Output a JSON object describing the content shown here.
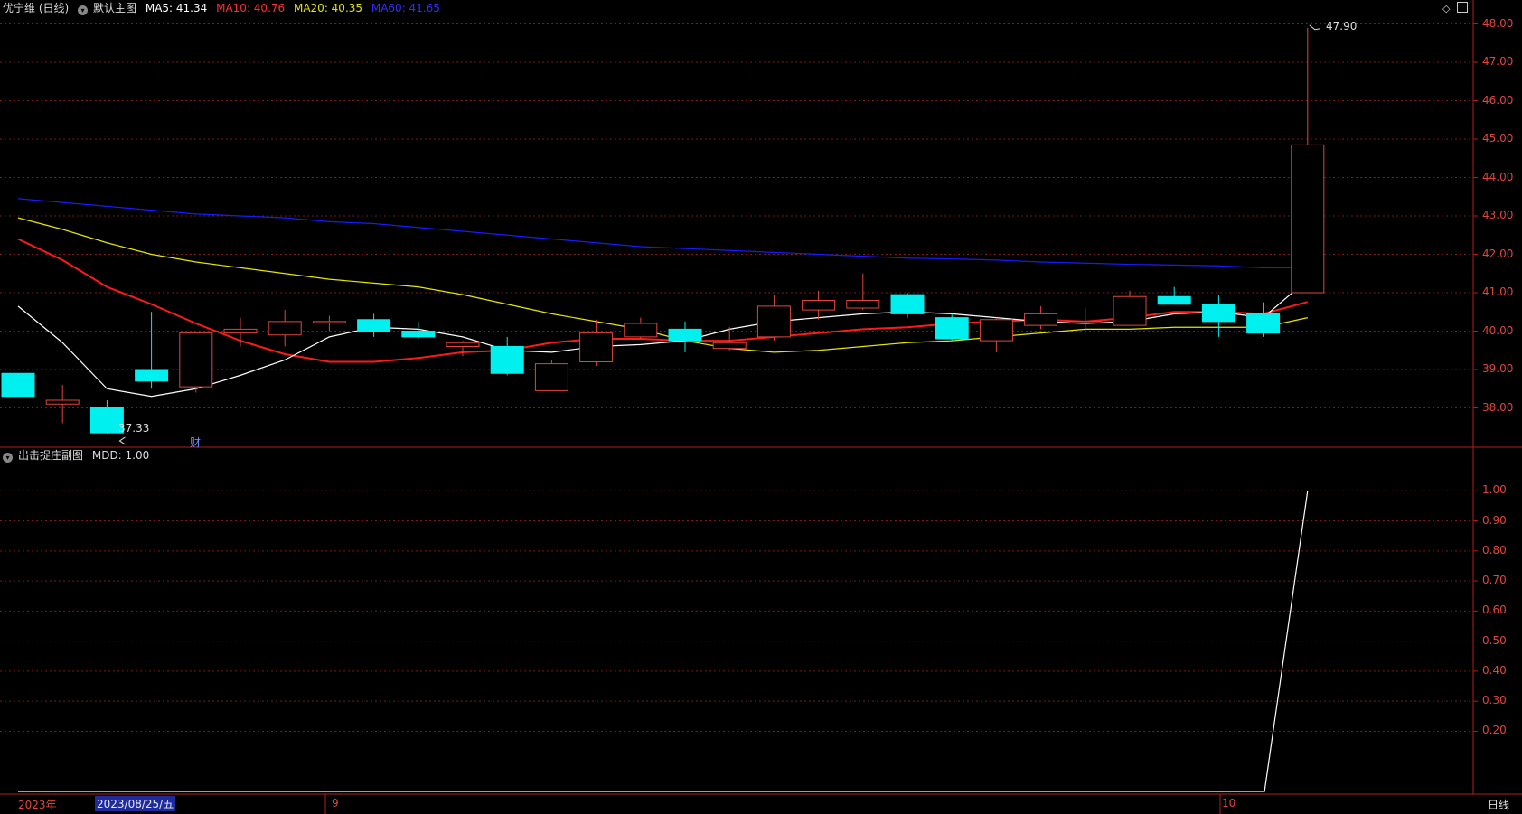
{
  "main_header": {
    "title": "优宁维 (日线)",
    "panel_label": "默认主图",
    "ma5": "MA5: 41.34",
    "ma10": "MA10: 40.76",
    "ma20": "MA20: 40.35",
    "ma60": "MA60: 41.65"
  },
  "sub_header": {
    "panel_label": "出击捉庄副图",
    "mdd": "MDD: 1.00"
  },
  "annotations": {
    "high": "47.90",
    "low": "37.33",
    "finance_mark": "财"
  },
  "x_axis": {
    "year": "2023年",
    "selected_date": "2023/08/25/五",
    "sep": "9",
    "oct": "10",
    "period": "日线"
  },
  "main_y_ticks": [
    "48.00",
    "47.00",
    "46.00",
    "45.00",
    "44.00",
    "43.00",
    "42.00",
    "41.00",
    "40.00",
    "39.00",
    "38.00"
  ],
  "sub_y_ticks": [
    "1.00",
    "0.90",
    "0.80",
    "0.70",
    "0.60",
    "0.50",
    "0.40",
    "0.30",
    "0.20"
  ],
  "colors": {
    "up": "#e0463b",
    "down": "#00f0f0",
    "ma5": "#ffffff",
    "ma10": "#ff1a1a",
    "ma20": "#e6e600",
    "ma60": "#1a1aff",
    "axis": "#b41e1e"
  },
  "chart_data": {
    "type": "candlestick",
    "candles": [
      {
        "o": 38.9,
        "h": 38.9,
        "l": 38.3,
        "c": 38.3
      },
      {
        "o": 38.1,
        "h": 38.6,
        "l": 37.6,
        "c": 38.2
      },
      {
        "o": 38.0,
        "h": 38.2,
        "l": 37.33,
        "c": 37.35
      },
      {
        "o": 39.0,
        "h": 40.5,
        "l": 38.5,
        "c": 38.7
      },
      {
        "o": 38.55,
        "h": 39.95,
        "l": 38.4,
        "c": 39.95
      },
      {
        "o": 39.95,
        "h": 40.35,
        "l": 39.6,
        "c": 40.05
      },
      {
        "o": 39.9,
        "h": 40.55,
        "l": 39.6,
        "c": 40.25
      },
      {
        "o": 40.25,
        "h": 40.4,
        "l": 40.0,
        "c": 40.25
      },
      {
        "o": 40.3,
        "h": 40.45,
        "l": 39.85,
        "c": 40.0
      },
      {
        "o": 40.0,
        "h": 40.25,
        "l": 39.8,
        "c": 39.85
      },
      {
        "o": 39.6,
        "h": 39.75,
        "l": 39.35,
        "c": 39.7
      },
      {
        "o": 39.6,
        "h": 39.85,
        "l": 38.85,
        "c": 38.9
      },
      {
        "o": 38.45,
        "h": 39.25,
        "l": 38.45,
        "c": 39.15
      },
      {
        "o": 39.2,
        "h": 40.3,
        "l": 39.1,
        "c": 39.95
      },
      {
        "o": 39.85,
        "h": 40.35,
        "l": 39.8,
        "c": 40.2
      },
      {
        "o": 40.05,
        "h": 40.25,
        "l": 39.45,
        "c": 39.75
      },
      {
        "o": 39.55,
        "h": 40.1,
        "l": 39.5,
        "c": 39.7
      },
      {
        "o": 39.85,
        "h": 40.95,
        "l": 39.75,
        "c": 40.65
      },
      {
        "o": 40.55,
        "h": 41.05,
        "l": 40.3,
        "c": 40.8
      },
      {
        "o": 40.6,
        "h": 41.5,
        "l": 40.55,
        "c": 40.8
      },
      {
        "o": 40.95,
        "h": 41.0,
        "l": 40.35,
        "c": 40.45
      },
      {
        "o": 40.35,
        "h": 40.45,
        "l": 39.75,
        "c": 39.8
      },
      {
        "o": 39.75,
        "h": 40.35,
        "l": 39.45,
        "c": 40.3
      },
      {
        "o": 40.15,
        "h": 40.65,
        "l": 40.05,
        "c": 40.45
      },
      {
        "o": 40.25,
        "h": 40.6,
        "l": 40.0,
        "c": 40.25
      },
      {
        "o": 40.15,
        "h": 41.05,
        "l": 40.15,
        "c": 40.9
      },
      {
        "o": 40.9,
        "h": 41.15,
        "l": 40.7,
        "c": 40.7
      },
      {
        "o": 40.7,
        "h": 40.95,
        "l": 39.85,
        "c": 40.25
      },
      {
        "o": 40.45,
        "h": 40.75,
        "l": 39.85,
        "c": 39.95
      },
      {
        "o": 41.0,
        "h": 47.9,
        "l": 41.0,
        "c": 44.85
      }
    ],
    "ma5": [
      40.65,
      39.7,
      38.5,
      38.3,
      38.5,
      38.85,
      39.25,
      39.85,
      40.1,
      40.05,
      39.85,
      39.5,
      39.45,
      39.6,
      39.65,
      39.75,
      40.05,
      40.25,
      40.35,
      40.45,
      40.5,
      40.45,
      40.35,
      40.25,
      40.2,
      40.25,
      40.45,
      40.5,
      40.35,
      41.34
    ],
    "ma10": [
      42.4,
      41.85,
      41.15,
      40.7,
      40.2,
      39.75,
      39.4,
      39.2,
      39.2,
      39.3,
      39.45,
      39.5,
      39.7,
      39.8,
      39.8,
      39.75,
      39.75,
      39.85,
      39.95,
      40.05,
      40.1,
      40.2,
      40.25,
      40.3,
      40.25,
      40.35,
      40.5,
      40.5,
      40.45,
      40.76
    ],
    "ma20": [
      42.95,
      42.65,
      42.3,
      42.0,
      41.8,
      41.65,
      41.5,
      41.35,
      41.25,
      41.15,
      40.95,
      40.7,
      40.45,
      40.25,
      40.05,
      39.75,
      39.55,
      39.45,
      39.5,
      39.6,
      39.7,
      39.75,
      39.85,
      39.95,
      40.05,
      40.05,
      40.1,
      40.1,
      40.1,
      40.35
    ],
    "ma60": [
      43.45,
      43.35,
      43.25,
      43.15,
      43.05,
      43.0,
      42.95,
      42.85,
      42.8,
      42.7,
      42.6,
      42.5,
      42.4,
      42.3,
      42.2,
      42.15,
      42.1,
      42.05,
      42.0,
      41.95,
      41.9,
      41.88,
      41.85,
      41.8,
      41.77,
      41.74,
      41.72,
      41.7,
      41.65,
      41.65
    ],
    "mdd": [
      0,
      0,
      0,
      0,
      0,
      0,
      0,
      0,
      0,
      0,
      0,
      0,
      0,
      0,
      0,
      0,
      0,
      0,
      0,
      0,
      0,
      0,
      0,
      0,
      0,
      0,
      0,
      0,
      0,
      1.0
    ],
    "main_ylim": [
      37.0,
      48.2
    ],
    "sub_ylim": [
      0,
      1.1
    ]
  }
}
